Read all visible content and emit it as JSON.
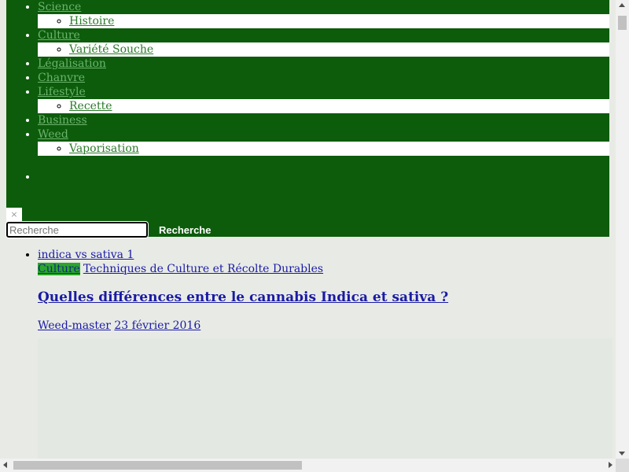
{
  "menu": {
    "items": [
      {
        "label": "Science",
        "sub": [
          "Histoire"
        ]
      },
      {
        "label": "Culture",
        "sub": [
          "Variété Souche"
        ]
      },
      {
        "label": "Légalisation"
      },
      {
        "label": "Chanvre"
      },
      {
        "label": "Lifestyle",
        "sub": [
          "Recette"
        ]
      },
      {
        "label": "Business"
      },
      {
        "label": "Weed",
        "sub": [
          "Vaporisation"
        ]
      }
    ],
    "colors": {
      "background": "#0c5c0c",
      "link": "#6db36d"
    }
  },
  "search": {
    "close_label": "×",
    "placeholder": "Recherche",
    "button_label": "Recherche"
  },
  "post": {
    "image_alt": "indica vs sativa 1",
    "category": "Culture",
    "category_link": "Techniques de Culture et Récolte Durables",
    "title": "Quelles différences entre le cannabis Indica et sativa ?",
    "author": "Weed-master",
    "date": "23 février 2016",
    "colors": {
      "badge": "#2ca52c",
      "link": "#1a1aa6"
    }
  }
}
